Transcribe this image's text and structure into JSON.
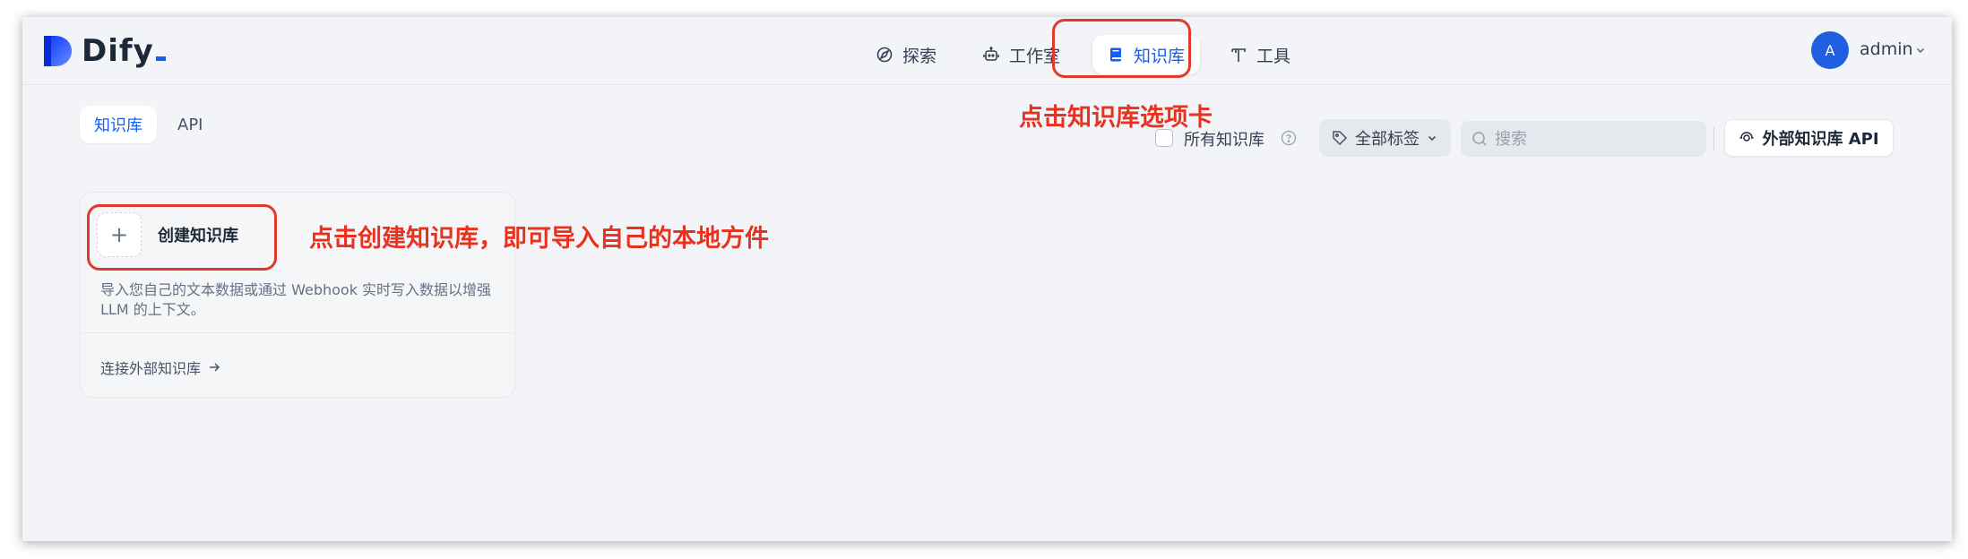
{
  "app": {
    "logo_text": "Dify",
    "brand_color": "#155eef"
  },
  "nav": {
    "items": [
      {
        "label": "探索",
        "icon": "compass-icon"
      },
      {
        "label": "工作室",
        "icon": "robot-icon"
      },
      {
        "label": "知识库",
        "icon": "book-icon",
        "active": true
      },
      {
        "label": "工具",
        "icon": "hammer-icon"
      }
    ]
  },
  "user": {
    "avatar_initial": "A",
    "name": "admin"
  },
  "subtabs": [
    {
      "label": "知识库",
      "active": true
    },
    {
      "label": "API"
    }
  ],
  "filters": {
    "all_datasets_label": "所有知识库",
    "tags_label": "全部标签",
    "search_placeholder": "搜索",
    "external_api_label": "外部知识库 API"
  },
  "create_card": {
    "title": "创建知识库",
    "description": "导入您自己的文本数据或通过 Webhook 实时写入数据以增强 LLM 的上下文。",
    "external_link": "连接外部知识库"
  },
  "annotations": {
    "tab_hint": "点击知识库选项卡",
    "create_hint": "点击创建知识库，即可导入自己的本地方件"
  },
  "colors": {
    "annotation": "#e8321f",
    "accent": "#155eef",
    "avatar": "#1f5fe0"
  }
}
